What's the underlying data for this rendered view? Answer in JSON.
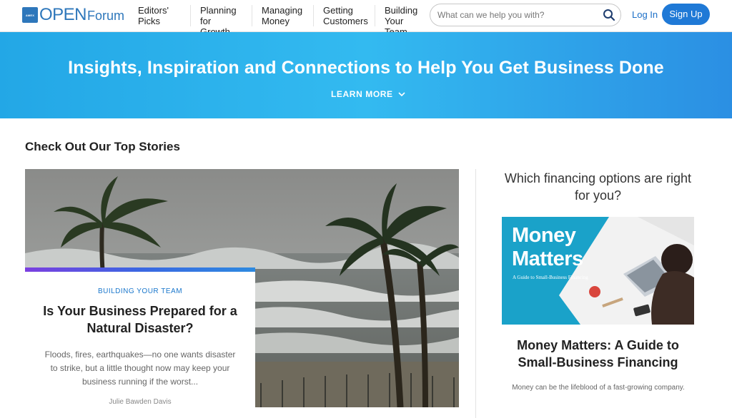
{
  "header": {
    "logo_brand": "AMERICAN EXPRESS",
    "logo_open": "OPEN",
    "logo_forum": "Forum",
    "nav": [
      {
        "line1": "Editors'",
        "line2": "Picks"
      },
      {
        "line1": "Planning",
        "line2": "for Growth"
      },
      {
        "line1": "Managing",
        "line2": "Money"
      },
      {
        "line1": "Getting",
        "line2": "Customers"
      },
      {
        "line1": "Building",
        "line2": "Your Team"
      }
    ],
    "search_placeholder": "What can we help you with?",
    "login_label": "Log In",
    "signup_label": "Sign Up"
  },
  "hero": {
    "title": "Insights, Inspiration and Connections to Help You Get Business Done",
    "learn_more": "LEARN MORE"
  },
  "section": {
    "title": "Check Out Our Top Stories"
  },
  "feature": {
    "category": "BUILDING YOUR TEAM",
    "title": "Is Your Business Prepared for a Natural Disaster?",
    "excerpt": "Floods, fires, earthquakes—no one wants disaster to strike, but a little thought now may keep your business running if the worst...",
    "author": "Julie Bawden Davis"
  },
  "sidebar": {
    "heading": "Which financing options are right for you?",
    "image_line1": "Money",
    "image_line2": "Matters",
    "image_subtitle": "A Guide to Small-Business Financing",
    "title": "Money Matters: A Guide to Small-Business Financing",
    "excerpt": "Money can be the lifeblood of a fast-growing company."
  },
  "colors": {
    "brand_blue": "#2e77bb",
    "signup_blue": "#1f79d6",
    "hero_cyan": "#33baf0",
    "category_blue": "#1a77cc"
  }
}
